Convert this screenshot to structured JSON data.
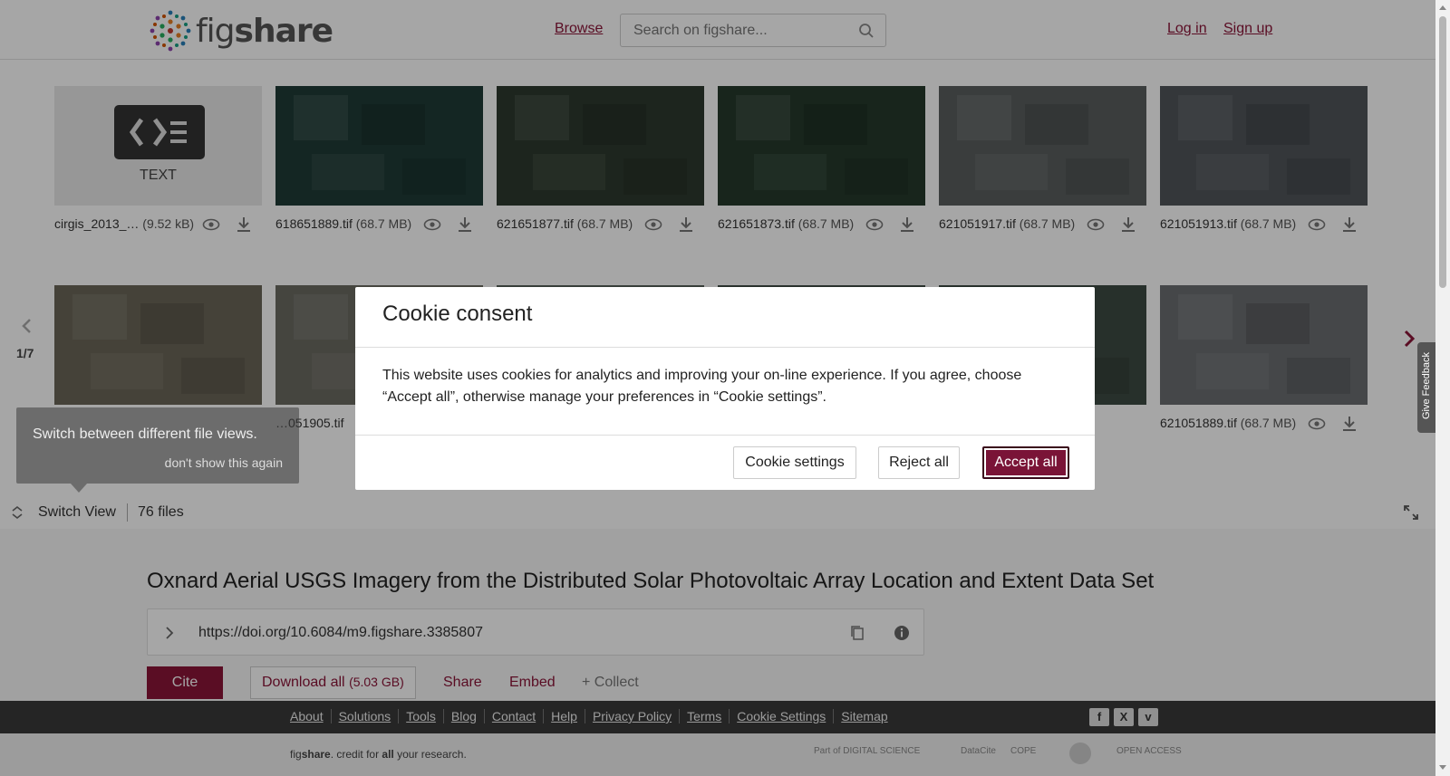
{
  "header": {
    "logo_text_fig": "fig",
    "logo_text_share": "share",
    "browse": "Browse",
    "search_placeholder": "Search on figshare...",
    "login": "Log in",
    "signup": "Sign up"
  },
  "files_row1": [
    {
      "name": "cirgis_2013_…",
      "size": "(9.52 kB)",
      "kind": "text",
      "type_label": "TEXT"
    },
    {
      "name": "618651889.tif",
      "size": "(68.7 MB)",
      "color": "#1f3b36"
    },
    {
      "name": "621651877.tif",
      "size": "(68.7 MB)",
      "color": "#2d3a2e"
    },
    {
      "name": "621651873.tif",
      "size": "(68.7 MB)",
      "color": "#253a2c"
    },
    {
      "name": "621051917.tif",
      "size": "(68.7 MB)",
      "color": "#5a5f5f"
    },
    {
      "name": "621051913.tif",
      "size": "(68.7 MB)",
      "color": "#50555a"
    }
  ],
  "files_row2": [
    {
      "name": "",
      "size": "",
      "color": "#6b6658"
    },
    {
      "name": "…051905.tif",
      "size": "",
      "color": "#6b6a62"
    },
    {
      "name": "",
      "size": "",
      "color": "#556058"
    },
    {
      "name": "",
      "size": "",
      "color": "#3f4c44"
    },
    {
      "name": "",
      "size": "",
      "color": "#3d4a42"
    },
    {
      "name": "621051889.tif",
      "size": "(68.7 MB)",
      "color": "#6a6d70"
    }
  ],
  "pager": {
    "current": "1/7"
  },
  "tooltip": {
    "title": "Switch between different file views.",
    "dismiss": "don't show this again"
  },
  "switch_bar": {
    "switch_view": "Switch View",
    "files_count": "76 files"
  },
  "dataset": {
    "title": "Oxnard Aerial USGS Imagery from the Distributed Solar Photovoltaic Array Location and Extent Data Set",
    "doi": "https://doi.org/10.6084/m9.figshare.3385807",
    "cite": "Cite",
    "download_all": "Download all",
    "download_size": "(5.03 GB)",
    "share": "Share",
    "embed": "Embed",
    "collect": "+ Collect"
  },
  "footer": {
    "links": [
      "About",
      "Solutions",
      "Tools",
      "Blog",
      "Contact",
      "Help",
      "Privacy Policy",
      "Terms",
      "Cookie Settings",
      "Sitemap"
    ],
    "tagline_fig": "fig",
    "tagline_share": "share",
    "tagline_rest1": ". credit for ",
    "tagline_all": "all",
    "tagline_rest2": " your research.",
    "partners": [
      "Part of DIGITAL SCIENCE",
      "DataCite",
      "COPE",
      "",
      "OPEN ACCESS"
    ]
  },
  "feedback": "Give Feedback",
  "modal": {
    "title": "Cookie consent",
    "body": "This website uses cookies for analytics and improving your on-line experience. If you agree, choose “Accept all”, otherwise manage your preferences in “Cookie settings”.",
    "cookie_settings": "Cookie settings",
    "reject_all": "Reject all",
    "accept_all": "Accept all"
  },
  "colors": {
    "brand": "#8a1538"
  }
}
